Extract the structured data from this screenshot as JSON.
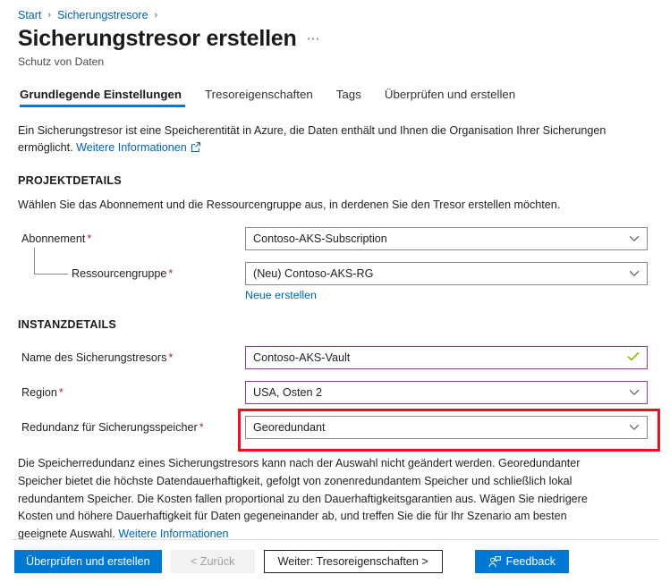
{
  "breadcrumb": {
    "items": [
      {
        "label": "Start"
      },
      {
        "label": "Sicherungstresore"
      }
    ],
    "separator": "›"
  },
  "header": {
    "title": "Sicherungstresor erstellen",
    "ellipsis": "⋯",
    "subtitle": "Schutz von Daten"
  },
  "tabs": [
    {
      "label": "Grundlegende Einstellungen",
      "active": true
    },
    {
      "label": "Tresoreigenschaften",
      "active": false
    },
    {
      "label": "Tags",
      "active": false
    },
    {
      "label": "Überprüfen und erstellen",
      "active": false
    }
  ],
  "intro": {
    "text": "Ein Sicherungstresor ist eine Speicherentität in Azure, die Daten enthält und Ihnen die Organisation Ihrer Sicherungen ermöglicht.",
    "link": "Weitere Informationen",
    "link_icon": "external-link-icon"
  },
  "project_details": {
    "heading": "PROJEKTDETAILS",
    "description": "Wählen Sie das Abonnement und die Ressourcengruppe aus, in derdenen Sie den Tresor erstellen möchten.",
    "subscription": {
      "label": "Abonnement",
      "required": "*",
      "value": "Contoso-AKS-Subscription"
    },
    "resource_group": {
      "label": "Ressourcengruppe",
      "required": "*",
      "value": "(Neu) Contoso-AKS-RG",
      "create_new_link": "Neue erstellen"
    }
  },
  "instance_details": {
    "heading": "INSTANZDETAILS",
    "vault_name": {
      "label": "Name des Sicherungstresors",
      "required": "*",
      "value": "Contoso-AKS-Vault",
      "status_icon": "checkmark-icon"
    },
    "region": {
      "label": "Region",
      "required": "*",
      "value": "USA, Osten 2"
    },
    "redundancy": {
      "label": "Redundanz für Sicherungsspeicher",
      "required": "*",
      "value": "Georedundant",
      "highlighted": true
    }
  },
  "info": {
    "text": "Die Speicherredundanz eines Sicherungstresors kann nach der Auswahl nicht geändert werden. Georedundanter Speicher bietet die höchste Datendauerhaftigkeit, gefolgt von zonenredundantem Speicher und schließlich lokal redundantem Speicher. Die Kosten fallen proportional zu den Dauerhaftigkeitsgarantien aus. Wägen Sie niedrigere Kosten und höhere Dauerhaftigkeit für Daten gegeneinander ab, und treffen Sie die für Ihr Szenario am besten geeignete Auswahl.",
    "link": "Weitere Informationen"
  },
  "footer": {
    "review_create": "Überprüfen und erstellen",
    "back": "< Zurück",
    "next": "Weiter: Tresoreigenschaften >",
    "feedback": "Feedback",
    "feedback_icon": "feedback-person-icon"
  },
  "colors": {
    "accent": "#0078d4",
    "link": "#0063b1",
    "required": "#a4262c",
    "valid_border": "#8e3a9c",
    "check": "#7fba00",
    "highlight": "#e81123",
    "field_border": "#8a8886"
  }
}
